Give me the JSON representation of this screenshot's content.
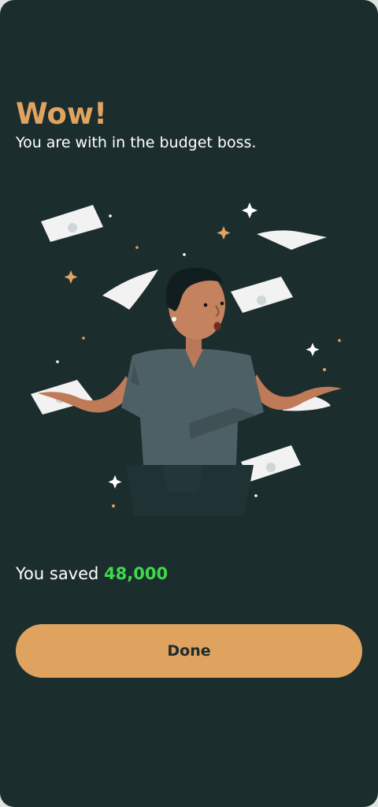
{
  "header": {
    "title": "Wow!",
    "subtitle": "You are with in the budget boss."
  },
  "illustration": {
    "icon": "person-shrugging-with-flying-money-illustration"
  },
  "summary": {
    "label": "You saved",
    "amount": "48,000"
  },
  "actions": {
    "done_label": "Done"
  },
  "colors": {
    "background": "#1c2d2e",
    "accent": "#dfa35f",
    "heading": "#e0a360",
    "amount": "#3fd94a",
    "text": "#ffffff"
  }
}
